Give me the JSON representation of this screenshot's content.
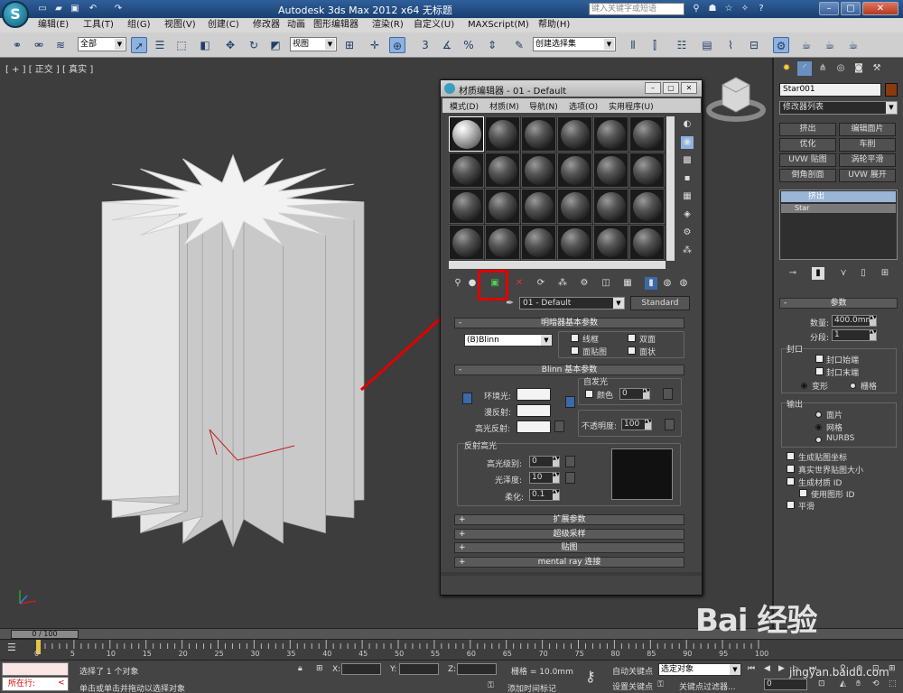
{
  "app": {
    "logo": "S",
    "title": "Autodesk 3ds Max  2012 x64      无标题",
    "search_placeholder": "键入关键字或短语",
    "colors": {
      "title_bar": "#1b3f70",
      "accent_red": "#e00000",
      "selection_blue": "#9ab5d6",
      "object_color": "#8b3a0f"
    }
  },
  "menu": [
    "编辑(E)",
    "工具(T)",
    "组(G)",
    "视图(V)",
    "创建(C)",
    "修改器",
    "动画",
    "图形编辑器",
    "渲染(R)",
    "自定义(U)",
    "MAXScript(M)",
    "帮助(H)"
  ],
  "toolbar": {
    "filter_select": "全部",
    "ref_coord": "视图",
    "named_selection": "创建选择集",
    "snap_3": "3",
    "snap_pct": "%"
  },
  "viewport": {
    "label": "[ + ] [ 正交 ] [ 真实 ]"
  },
  "material_editor": {
    "title": "材质编辑器 - 01 - Default",
    "menu": [
      "模式(D)",
      "材质(M)",
      "导航(N)",
      "选项(O)",
      "实用程序(U)"
    ],
    "material_name": "01 - Default",
    "material_type": "Standard",
    "shader_rollout": "明暗器基本参数",
    "shader_type": "(B)Blinn",
    "shader_opts": [
      "线框",
      "双面",
      "面贴图",
      "面状"
    ],
    "blinn_rollout": "Blinn 基本参数",
    "self_illum": "自发光",
    "color_label": "颜色",
    "self_illum_value": "0",
    "ambient": "环境光:",
    "diffuse": "漫反射:",
    "specular": "高光反射:",
    "opacity_label": "不透明度:",
    "opacity_value": "100",
    "spec_group": "反射高光",
    "spec_level_label": "高光级别:",
    "spec_level_value": "0",
    "gloss_label": "光泽度:",
    "gloss_value": "10",
    "soften_label": "柔化:",
    "soften_value": "0.1",
    "rollouts": [
      "扩展参数",
      "超级采样",
      "贴图",
      "mental ray 连接"
    ],
    "plus": "+",
    "minus": "-"
  },
  "command_panel": {
    "object_name": "Star001",
    "modifier_list": "修改器列表",
    "mod_buttons": [
      "挤出",
      "编辑面片",
      "优化",
      "车削",
      "UVW 贴图",
      "涡轮平滑",
      "倒角剖面",
      "UVW 展开"
    ],
    "stack": [
      "挤出",
      "Star"
    ],
    "params_title": "参数",
    "amount_label": "数量:",
    "amount_value": "400.0mm",
    "segments_label": "分段:",
    "segments_value": "1",
    "capping_title": "封口",
    "cap_start": "封口始端",
    "cap_end": "封口末端",
    "morph": "变形",
    "grid": "栅格",
    "output_title": "输出",
    "out_patch": "面片",
    "out_mesh": "网格",
    "out_nurbs": "NURBS",
    "gen_map": "生成贴图坐标",
    "real_world": "真实世界贴图大小",
    "gen_mat_id": "生成材质 ID",
    "use_shape_id": "使用图形 ID",
    "smooth": "平滑"
  },
  "timeline": {
    "frame_display": "0 / 100",
    "ticks": [
      "0",
      "5",
      "10",
      "15",
      "20",
      "25",
      "30",
      "35",
      "40",
      "45",
      "50",
      "55",
      "60",
      "65",
      "70",
      "75",
      "80",
      "85",
      "90",
      "95",
      "100"
    ]
  },
  "status": {
    "listener": "所在行:",
    "selected": "选择了 1 个对象",
    "hint": "单击或单击并拖动以选择对象",
    "x_label": "X:",
    "y_label": "Y:",
    "z_label": "Z:",
    "grid": "栅格 = 10.0mm",
    "add_time_tag": "添加时间标记",
    "auto_key": "自动关键点",
    "set_key": "设置关键点",
    "selected_set": "选定对象",
    "key_filters": "关键点过滤器...",
    "frame": "0"
  },
  "watermark": {
    "logo": "Bai 经验",
    "url": "jingyan.baidu.com"
  }
}
